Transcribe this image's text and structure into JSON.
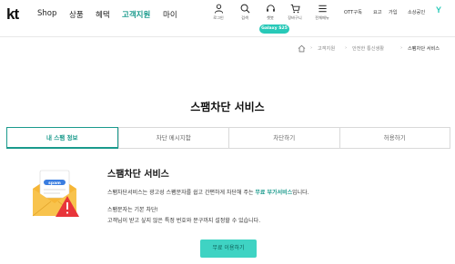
{
  "brand": {
    "logo_text": "kt",
    "accent": "#1a9a8c",
    "pill_color": "#28c9b8"
  },
  "nav": {
    "menus": [
      "Shop",
      "상품",
      "혜택",
      "고객지원",
      "마이"
    ],
    "active_menu": "고객지원",
    "utilities": [
      {
        "icon": "user-icon",
        "label": "로그인"
      },
      {
        "icon": "search-icon",
        "label": "검색"
      },
      {
        "icon": "headset-icon",
        "label": "챗봇"
      },
      {
        "icon": "cart-icon",
        "label": "장바구니"
      },
      {
        "icon": "menu-icon",
        "label": "전체메뉴"
      }
    ],
    "galaxy_badge": "Galaxy S25",
    "right_links": [
      "OTT구독",
      "요고",
      "가입",
      "소상공인"
    ],
    "y_icon": "Y"
  },
  "breadcrumb": [
    "고객지원",
    "안전한 통신생활",
    "스팸차단 서비스"
  ],
  "page_title": "스팸차단 서비스",
  "tabs": [
    {
      "label": "내 스팸 정보",
      "active": true
    },
    {
      "label": "차단 메시지함",
      "active": false
    },
    {
      "label": "차단하기",
      "active": false
    },
    {
      "label": "허용하기",
      "active": false
    }
  ],
  "section": {
    "title": "스팸차단 서비스",
    "desc_prefix": "스팸차단서비스는 광고성 스팸문자를 쉽고 간편하게 차단해 주는 ",
    "desc_highlight": "무료 부가서비스",
    "desc_suffix": "입니다.",
    "note_line1": "스팸문자는 기본 차단!",
    "note_line2": "고객님이 받고 싶지 않은 특정 번호와 문구까지 설정할 수 있습니다.",
    "illust_label": "spam"
  },
  "cta_label": "무료 이용하기"
}
